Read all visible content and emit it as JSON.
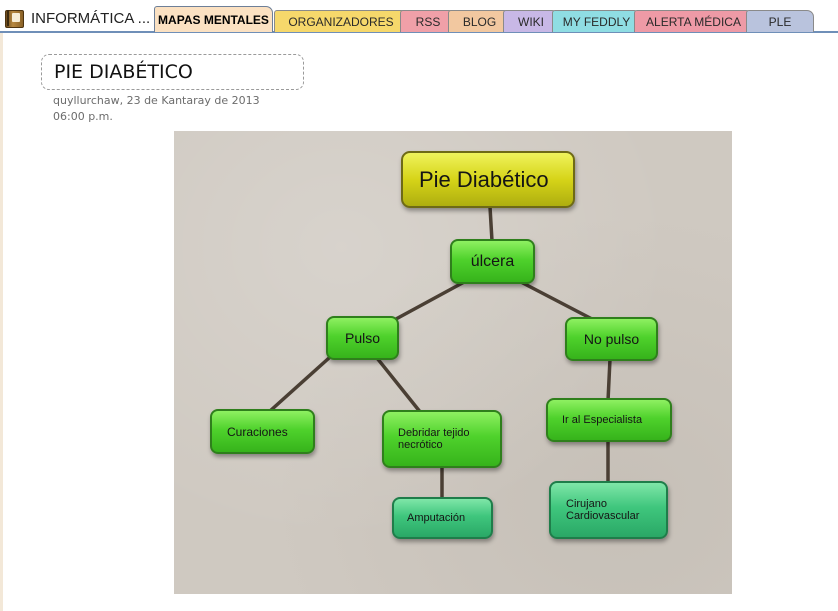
{
  "notebook": {
    "title": "INFORMÁTICA ...",
    "icon": "notebook-icon"
  },
  "tabs": [
    {
      "label": "MAPAS MENTALES",
      "color": "#fbe1c2",
      "active": true
    },
    {
      "label": "ORGANIZADORES",
      "color": "#f6d86b",
      "active": false
    },
    {
      "label": "RSS",
      "color": "#f0a0a8",
      "active": false
    },
    {
      "label": "BLOG",
      "color": "#f2c8a0",
      "active": false
    },
    {
      "label": "WIKI",
      "color": "#c8b8e6",
      "active": false
    },
    {
      "label": "MY FEDDLY",
      "color": "#8fdde3",
      "active": false
    },
    {
      "label": "ALERTA MÉDICA",
      "color": "#ee9aa6",
      "active": false
    },
    {
      "label": "PLE",
      "color": "#b9c3dd",
      "active": false
    }
  ],
  "page": {
    "title": "PIE DIABÉTICO",
    "date": "quyllurchaw, 23 de Kantaray de 2013",
    "time": "06:00 p.m."
  },
  "concept_map": {
    "root": "Pie Diabético",
    "ulcera": "úlcera",
    "pulso": "Pulso",
    "no_pulso": "No pulso",
    "curaciones": "Curaciones",
    "debridar_1": "Debridar tejido",
    "debridar_2": "necrótico",
    "especialista": "Ir al Especialista",
    "amputacion": "Amputación",
    "cirujano_1": "Cirujano",
    "cirujano_2": "Cardiovascular"
  }
}
